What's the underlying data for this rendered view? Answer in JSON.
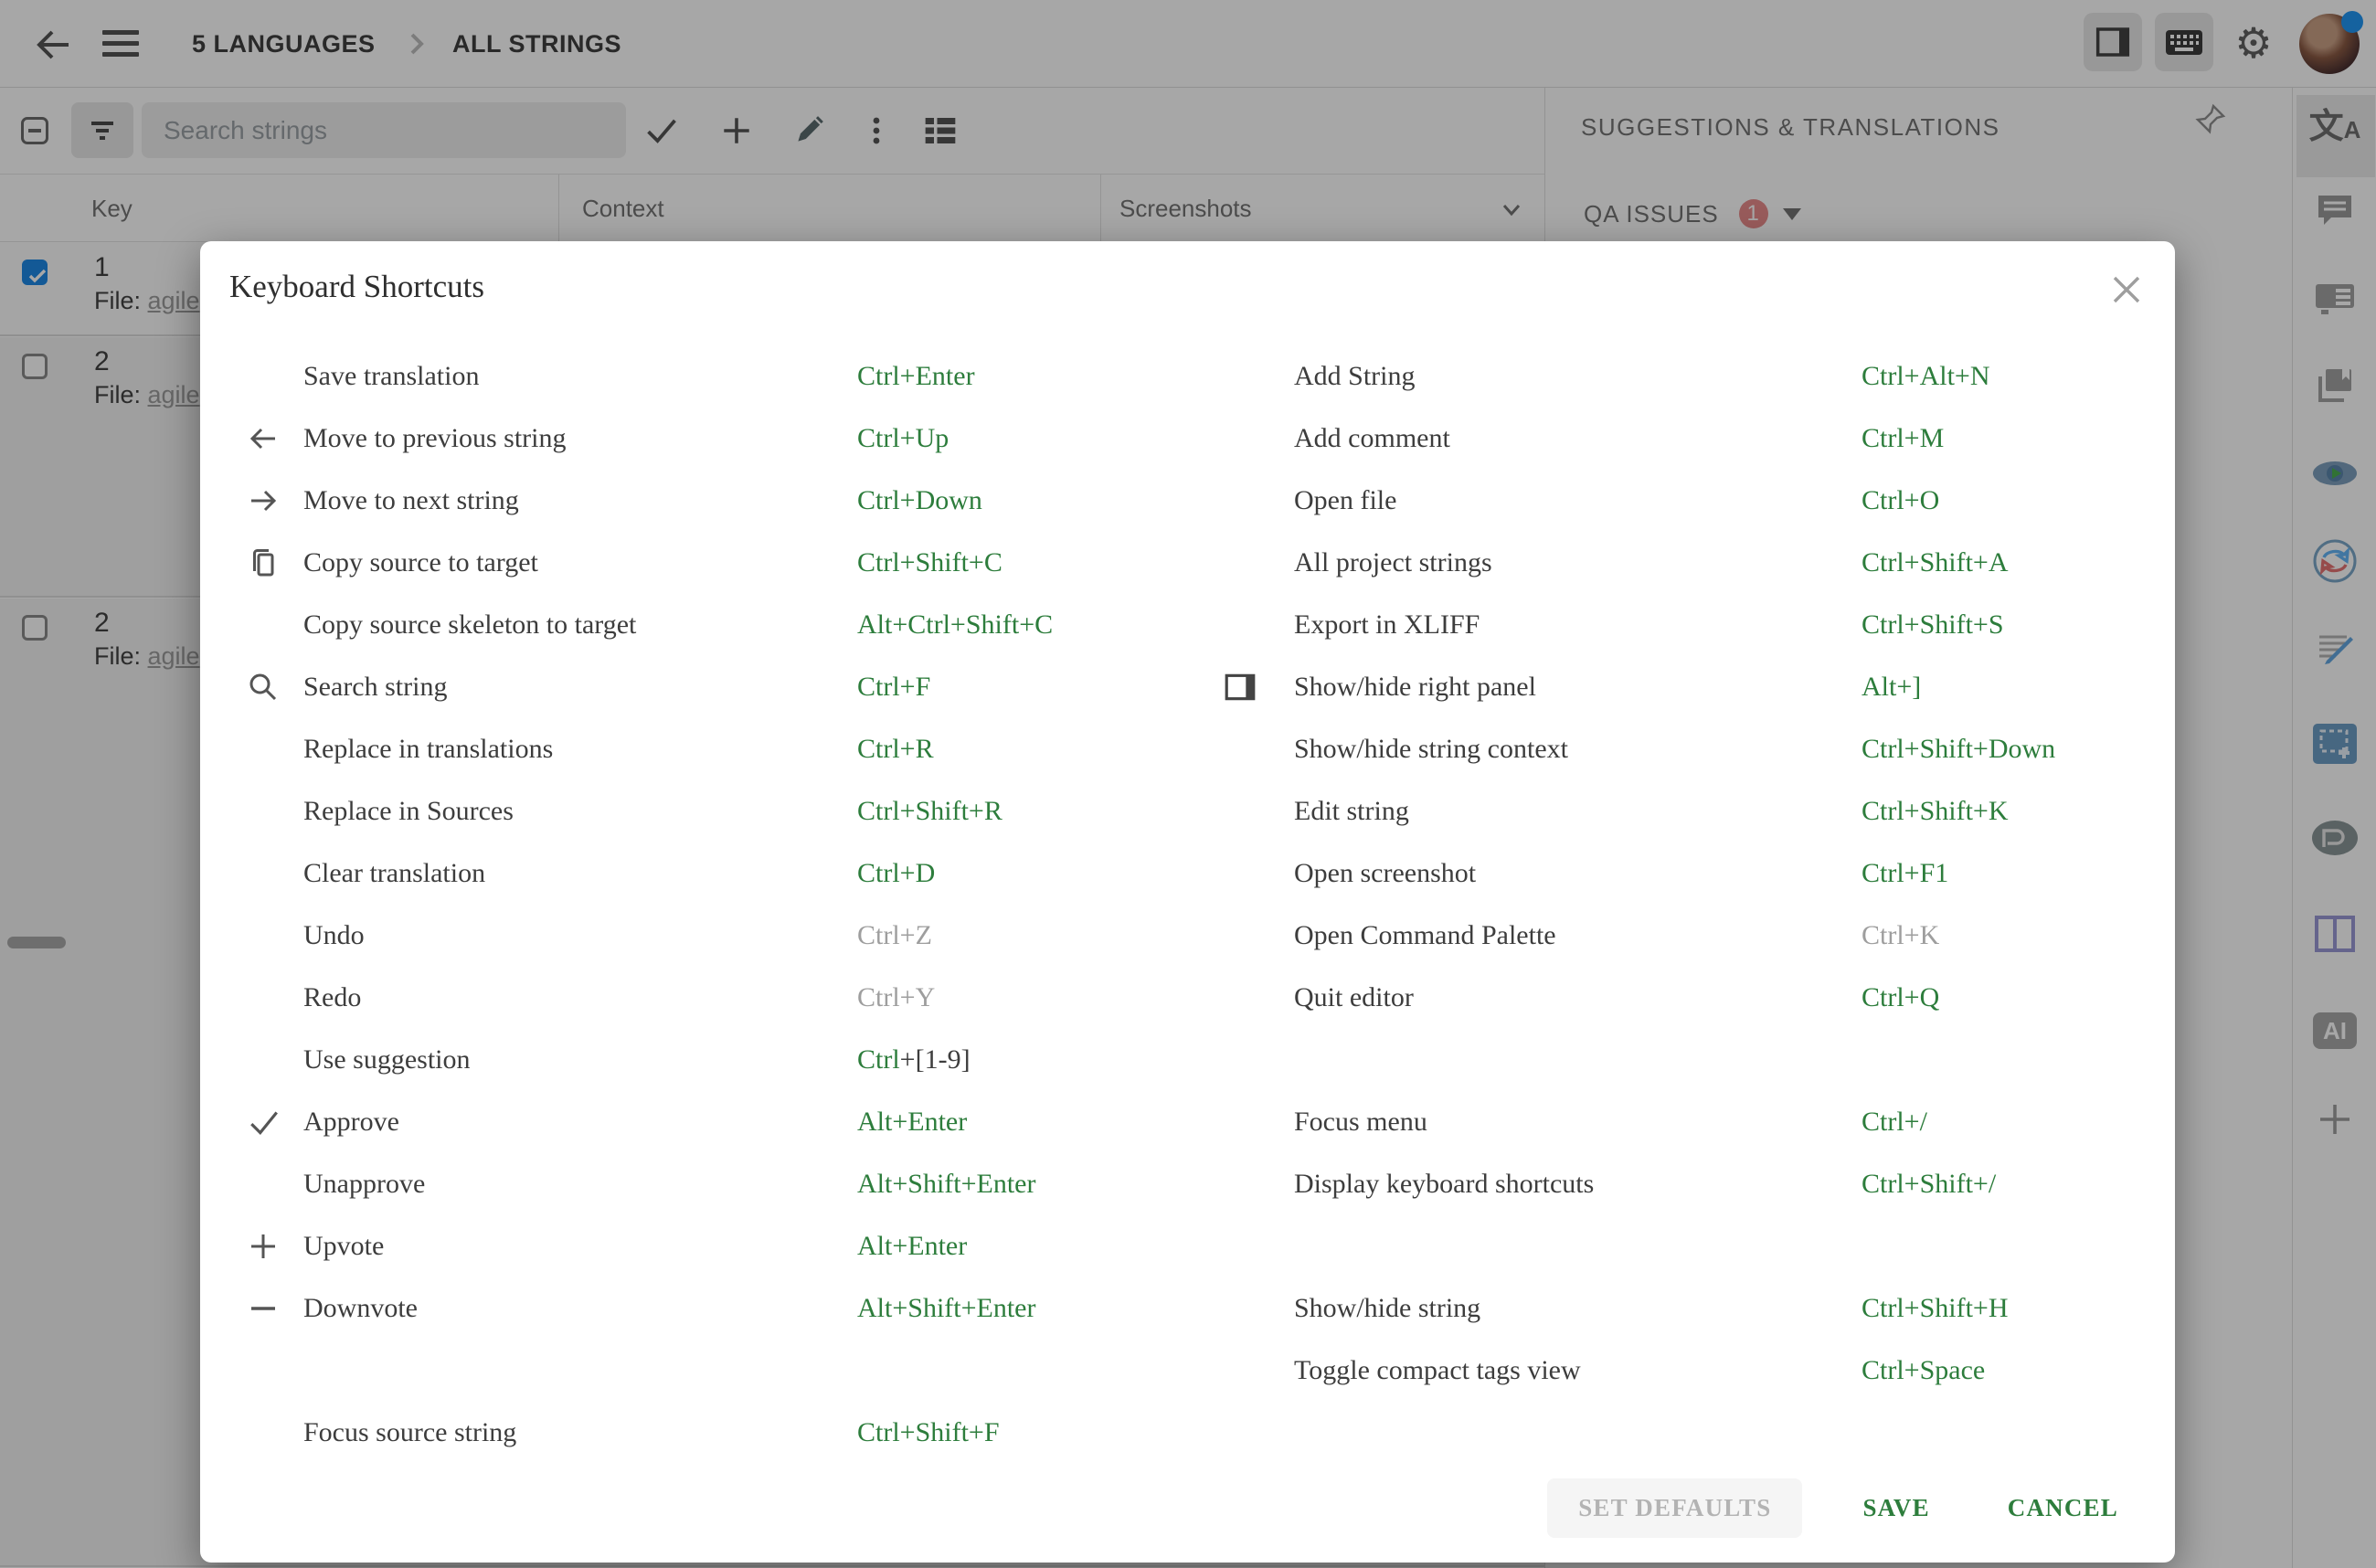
{
  "colors": {
    "green": "#2d7d3c",
    "muted": "#9e9e9e",
    "accent_blue": "#1e88e5",
    "badge_red": "#e98b8b"
  },
  "header": {
    "breadcrumb": [
      "5 LANGUAGES",
      "ALL STRINGS"
    ]
  },
  "toolbar": {
    "search_placeholder": "Search strings"
  },
  "table": {
    "columns": [
      "Key",
      "Context",
      "Screenshots"
    ],
    "rows": [
      {
        "key": "1",
        "file_label": "File:",
        "file_link": "agile",
        "checked": true
      },
      {
        "key": "2",
        "file_label": "File:",
        "file_link": "agile",
        "checked": false
      },
      {
        "key": "2",
        "file_label": "File:",
        "file_link": "agile",
        "checked": false
      }
    ]
  },
  "right_panel": {
    "title": "SUGGESTIONS & TRANSLATIONS",
    "qa_label": "QA ISSUES",
    "qa_count": "1"
  },
  "sidebar": {
    "icons": [
      "translate",
      "comments",
      "context-card",
      "glossary-book",
      "preview-eye",
      "translation-cycle",
      "draft-edit",
      "screenshot-tag",
      "p-badge",
      "split-view",
      "ai",
      "add"
    ]
  },
  "modal": {
    "title": "Keyboard Shortcuts",
    "left": [
      {
        "label": "Save translation",
        "icon": "",
        "keys": [
          {
            "t": "Ctrl+Enter",
            "c": "green"
          }
        ]
      },
      {
        "label": "Move to previous string",
        "icon": "arrow-left",
        "keys": [
          {
            "t": "Ctrl+Up",
            "c": "green"
          }
        ]
      },
      {
        "label": "Move to next string",
        "icon": "arrow-right",
        "keys": [
          {
            "t": "Ctrl+Down",
            "c": "green"
          }
        ]
      },
      {
        "label": "Copy source to target",
        "icon": "copy",
        "keys": [
          {
            "t": "Ctrl+Shift+C",
            "c": "green"
          }
        ]
      },
      {
        "label": "Copy source skeleton to target",
        "icon": "",
        "keys": [
          {
            "t": "Alt+Ctrl+Shift+C",
            "c": "green"
          }
        ]
      },
      {
        "label": "Search string",
        "icon": "search",
        "keys": [
          {
            "t": "Ctrl+F",
            "c": "green"
          }
        ]
      },
      {
        "label": "Replace in translations",
        "icon": "",
        "keys": [
          {
            "t": "Ctrl+R",
            "c": "green"
          }
        ]
      },
      {
        "label": "Replace in Sources",
        "icon": "",
        "keys": [
          {
            "t": "Ctrl+Shift+R",
            "c": "green"
          }
        ]
      },
      {
        "label": "Clear translation",
        "icon": "",
        "keys": [
          {
            "t": "Ctrl+D",
            "c": "green"
          }
        ]
      },
      {
        "label": "Undo",
        "icon": "",
        "keys": [
          {
            "t": "Ctrl+Z",
            "c": "muted"
          }
        ]
      },
      {
        "label": "Redo",
        "icon": "",
        "keys": [
          {
            "t": "Ctrl+Y",
            "c": "muted"
          }
        ]
      },
      {
        "label": "Use suggestion",
        "icon": "",
        "keys": [
          {
            "t": "Ctrl",
            "c": "green"
          },
          {
            "t": "+[1-9]",
            "c": "dark"
          }
        ]
      },
      {
        "label": "Approve",
        "icon": "check",
        "keys": [
          {
            "t": "Alt+Enter",
            "c": "green"
          }
        ]
      },
      {
        "label": "Unapprove",
        "icon": "",
        "keys": [
          {
            "t": "Alt+Shift+Enter",
            "c": "green"
          }
        ]
      },
      {
        "label": "Upvote",
        "icon": "plus",
        "keys": [
          {
            "t": "Alt+Enter",
            "c": "green"
          }
        ]
      },
      {
        "label": "Downvote",
        "icon": "minus",
        "keys": [
          {
            "t": "Alt+Shift+Enter",
            "c": "green"
          }
        ]
      },
      {
        "spacer": true
      },
      {
        "label": "Focus source string",
        "icon": "",
        "keys": [
          {
            "t": "Ctrl+Shift+F",
            "c": "green"
          }
        ]
      }
    ],
    "right": [
      {
        "label": "Add String",
        "icon": "",
        "keys": [
          {
            "t": "Ctrl+Alt+N",
            "c": "green"
          }
        ]
      },
      {
        "label": "Add comment",
        "icon": "",
        "keys": [
          {
            "t": "Ctrl+M",
            "c": "green"
          }
        ]
      },
      {
        "label": "Open file",
        "icon": "",
        "keys": [
          {
            "t": "Ctrl+O",
            "c": "green"
          }
        ]
      },
      {
        "label": "All project strings",
        "icon": "",
        "keys": [
          {
            "t": "Ctrl+Shift+A",
            "c": "green"
          }
        ]
      },
      {
        "label": "Export in XLIFF",
        "icon": "",
        "keys": [
          {
            "t": "Ctrl+Shift+S",
            "c": "green"
          }
        ]
      },
      {
        "label": "Show/hide right panel",
        "icon": "panel",
        "keys": [
          {
            "t": "Alt+]",
            "c": "green"
          }
        ]
      },
      {
        "label": "Show/hide string context",
        "icon": "",
        "keys": [
          {
            "t": "Ctrl+Shift+Down",
            "c": "green"
          }
        ]
      },
      {
        "label": "Edit string",
        "icon": "",
        "keys": [
          {
            "t": "Ctrl+Shift+K",
            "c": "green"
          }
        ]
      },
      {
        "label": "Open screenshot",
        "icon": "",
        "keys": [
          {
            "t": "Ctrl+F1",
            "c": "green"
          }
        ]
      },
      {
        "label": "Open Command Palette",
        "icon": "",
        "keys": [
          {
            "t": "Ctrl+K",
            "c": "muted"
          }
        ]
      },
      {
        "label": "Quit editor",
        "icon": "",
        "keys": [
          {
            "t": "Ctrl+Q",
            "c": "green"
          }
        ]
      },
      {
        "spacer": true
      },
      {
        "label": "Focus menu",
        "icon": "",
        "keys": [
          {
            "t": "Ctrl+/",
            "c": "green"
          }
        ]
      },
      {
        "label": "Display keyboard shortcuts",
        "icon": "",
        "keys": [
          {
            "t": "Ctrl+Shift+/",
            "c": "green"
          }
        ]
      },
      {
        "spacer": true
      },
      {
        "label": "Show/hide string",
        "icon": "",
        "keys": [
          {
            "t": "Ctrl+Shift+H",
            "c": "green"
          }
        ]
      },
      {
        "label": "Toggle compact tags view",
        "icon": "",
        "keys": [
          {
            "t": "Ctrl+Space",
            "c": "green"
          }
        ]
      }
    ],
    "footer": {
      "set_defaults": "SET DEFAULTS",
      "save": "SAVE",
      "cancel": "CANCEL"
    }
  }
}
